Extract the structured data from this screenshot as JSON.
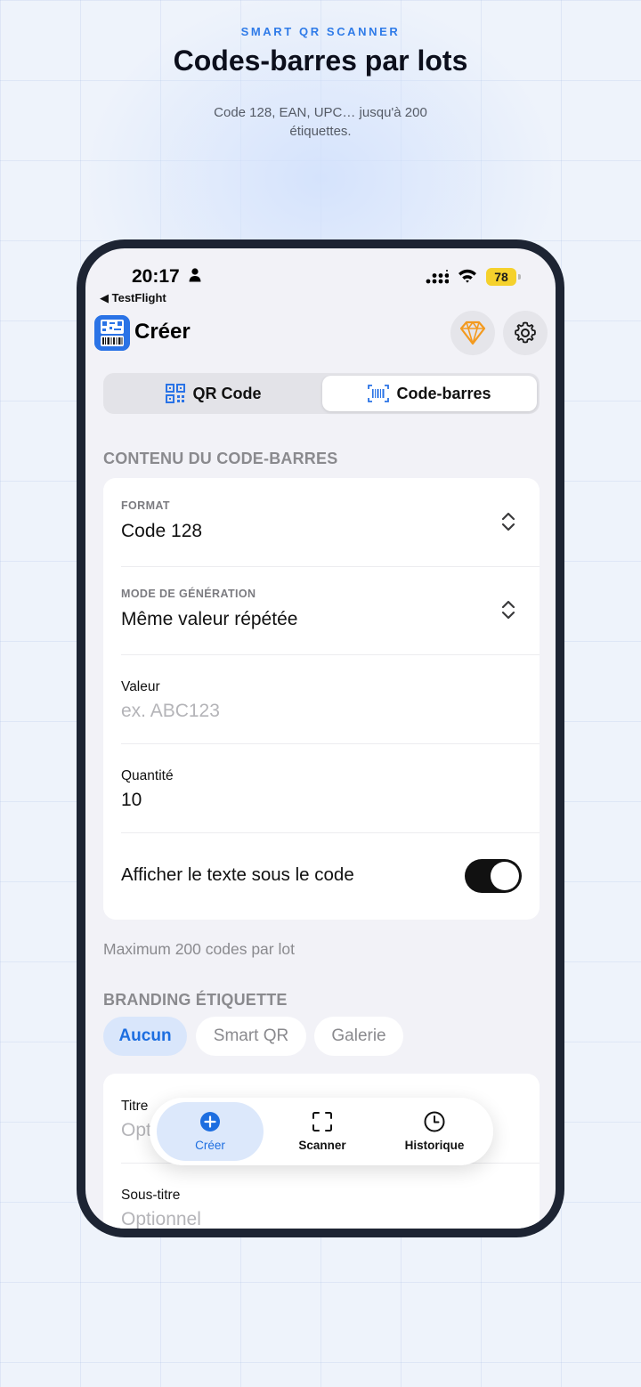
{
  "hero": {
    "eyebrow": "SMART QR SCANNER",
    "title": "Codes-barres par lots",
    "subtitle": "Code 128, EAN, UPC… jusqu'à 200 étiquettes."
  },
  "status_bar": {
    "time": "20:17",
    "back_app": "◀ TestFlight",
    "battery": "78"
  },
  "header": {
    "title": "Créer"
  },
  "segmented": {
    "qr_label": "QR Code",
    "barcode_label": "Code-barres",
    "selected": "Code-barres"
  },
  "barcode_content": {
    "section_title": "CONTENU DU CODE-BARRES",
    "format_caption": "FORMAT",
    "format_value": "Code 128",
    "mode_caption": "MODE DE GÉNÉRATION",
    "mode_value": "Même valeur répétée",
    "value_label": "Valeur",
    "value_placeholder": "ex. ABC123",
    "quantity_label": "Quantité",
    "quantity_value": "10",
    "show_text_label": "Afficher le texte sous le code",
    "show_text_on": true,
    "footer": "Maximum 200 codes par lot"
  },
  "branding": {
    "section_title": "BRANDING ÉTIQUETTE",
    "chips": [
      "Aucun",
      "Smart QR",
      "Galerie"
    ],
    "selected": "Aucun",
    "title_label": "Titre",
    "title_placeholder": "Opt",
    "subtitle_label": "Sous-titre",
    "subtitle_placeholder": "Optionnel"
  },
  "tabbar": {
    "create": "Créer",
    "scanner": "Scanner",
    "history": "Historique",
    "active": "Créer"
  },
  "colors": {
    "accent": "#1d6ee0",
    "toggle_on": "#111111",
    "premium": "#f39a1f",
    "battery": "#f5d12c"
  }
}
